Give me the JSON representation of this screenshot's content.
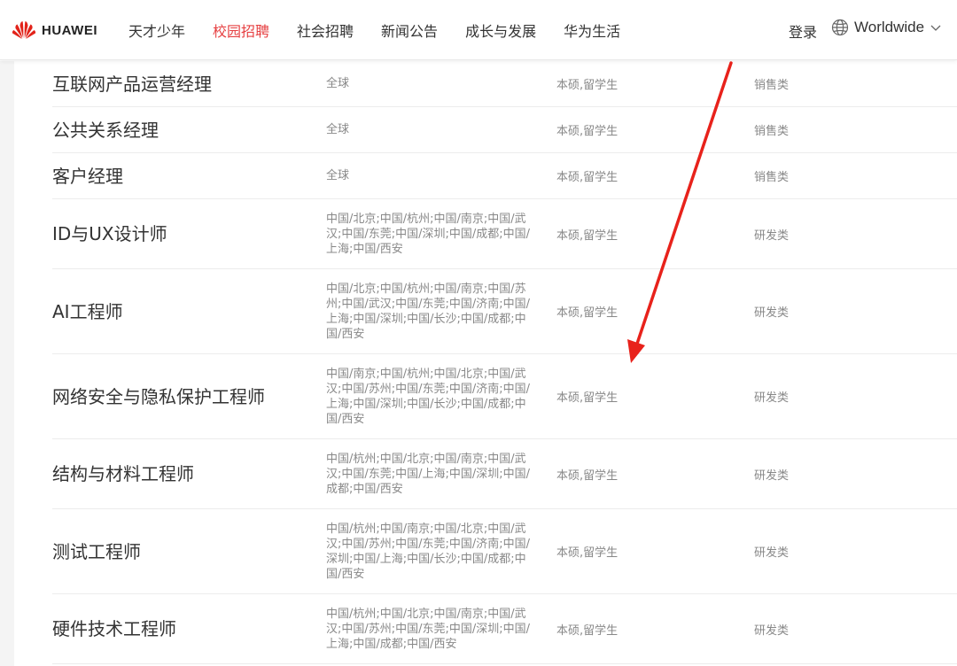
{
  "brand": {
    "name": "HUAWEI",
    "logo_color": "#e2231a"
  },
  "nav": {
    "items": [
      {
        "label": "天才少年",
        "active": false
      },
      {
        "label": "校园招聘",
        "active": true
      },
      {
        "label": "社会招聘",
        "active": false
      },
      {
        "label": "新闻公告",
        "active": false
      },
      {
        "label": "成长与发展",
        "active": false
      },
      {
        "label": "华为生活",
        "active": false
      }
    ],
    "active_color": "#e64042"
  },
  "header": {
    "login_label": "登录",
    "language": {
      "label": "Worldwide",
      "icon": "globe-icon",
      "caret": "chevron-down-icon"
    }
  },
  "jobs": [
    {
      "title": "互联网产品运营经理",
      "location": "全球",
      "degree": "本硕,留学生",
      "category": "销售类"
    },
    {
      "title": "公共关系经理",
      "location": "全球",
      "degree": "本硕,留学生",
      "category": "销售类"
    },
    {
      "title": "客户经理",
      "location": "全球",
      "degree": "本硕,留学生",
      "category": "销售类"
    },
    {
      "title": "ID与UX设计师",
      "location": "中国/北京;中国/杭州;中国/南京;中国/武汉;中国/东莞;中国/深圳;中国/成都;中国/上海;中国/西安",
      "degree": "本硕,留学生",
      "category": "研发类"
    },
    {
      "title": "AI工程师",
      "location": "中国/北京;中国/杭州;中国/南京;中国/苏州;中国/武汉;中国/东莞;中国/济南;中国/上海;中国/深圳;中国/长沙;中国/成都;中国/西安",
      "degree": "本硕,留学生",
      "category": "研发类"
    },
    {
      "title": "网络安全与隐私保护工程师",
      "location": "中国/南京;中国/杭州;中国/北京;中国/武汉;中国/苏州;中国/东莞;中国/济南;中国/上海;中国/深圳;中国/长沙;中国/成都;中国/西安",
      "degree": "本硕,留学生",
      "category": "研发类"
    },
    {
      "title": "结构与材料工程师",
      "location": "中国/杭州;中国/北京;中国/南京;中国/武汉;中国/东莞;中国/上海;中国/深圳;中国/成都;中国/西安",
      "degree": "本硕,留学生",
      "category": "研发类"
    },
    {
      "title": "测试工程师",
      "location": "中国/杭州;中国/南京;中国/北京;中国/武汉;中国/苏州;中国/东莞;中国/济南;中国/深圳;中国/上海;中国/长沙;中国/成都;中国/西安",
      "degree": "本硕,留学生",
      "category": "研发类"
    },
    {
      "title": "硬件技术工程师",
      "location": "中国/杭州;中国/北京;中国/南京;中国/武汉;中国/苏州;中国/东莞;中国/深圳;中国/上海;中国/成都;中国/西安",
      "degree": "本硕,留学生",
      "category": "研发类"
    }
  ],
  "annotation": {
    "type": "red-arrow",
    "color": "#e8221b"
  }
}
